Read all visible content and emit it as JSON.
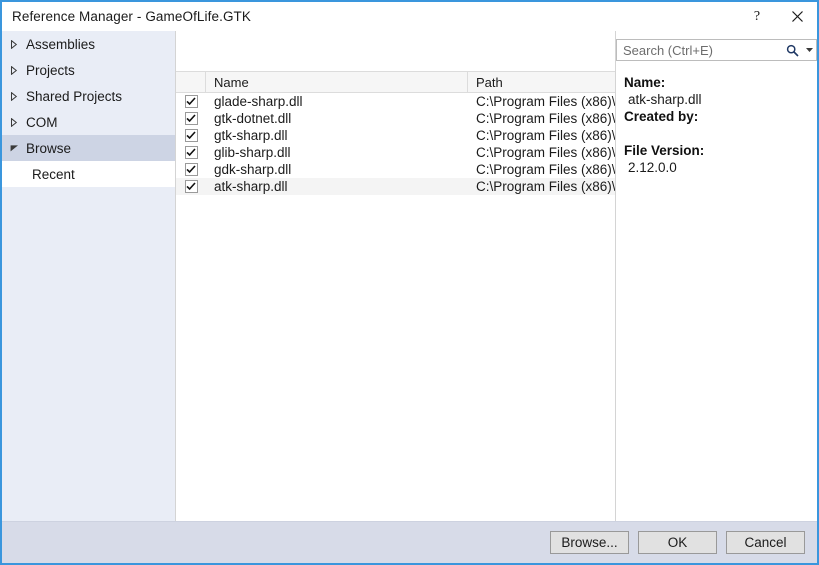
{
  "window": {
    "title": "Reference Manager - GameOfLife.GTK",
    "accent_color": "#3a96dd",
    "help_glyph": "?",
    "close_icon": "close-icon"
  },
  "sidebar": {
    "items": [
      {
        "label": "Assemblies",
        "state": "collapsed",
        "selected": false
      },
      {
        "label": "Projects",
        "state": "collapsed",
        "selected": false
      },
      {
        "label": "Shared Projects",
        "state": "collapsed",
        "selected": false
      },
      {
        "label": "COM",
        "state": "collapsed",
        "selected": false
      },
      {
        "label": "Browse",
        "state": "expanded",
        "selected": true
      },
      {
        "label": "Recent",
        "state": "child",
        "selected": false
      }
    ]
  },
  "search": {
    "placeholder": "Search (Ctrl+E)",
    "value": "",
    "icon": "search-icon",
    "caret": "chevron-down-icon"
  },
  "list": {
    "columns": [
      "",
      "Name",
      "Path"
    ],
    "rows": [
      {
        "checked": true,
        "name": "glade-sharp.dll",
        "path": "C:\\Program Files (x86)\\...",
        "selected": false
      },
      {
        "checked": true,
        "name": "gtk-dotnet.dll",
        "path": "C:\\Program Files (x86)\\...",
        "selected": false
      },
      {
        "checked": true,
        "name": "gtk-sharp.dll",
        "path": "C:\\Program Files (x86)\\...",
        "selected": false
      },
      {
        "checked": true,
        "name": "glib-sharp.dll",
        "path": "C:\\Program Files (x86)\\...",
        "selected": false
      },
      {
        "checked": true,
        "name": "gdk-sharp.dll",
        "path": "C:\\Program Files (x86)\\...",
        "selected": false
      },
      {
        "checked": true,
        "name": "atk-sharp.dll",
        "path": "C:\\Program Files (x86)\\...",
        "selected": true
      }
    ]
  },
  "details": {
    "name_label": "Name:",
    "name_value": "atk-sharp.dll",
    "created_by_label": "Created by:",
    "created_by_value": "",
    "file_version_label": "File Version:",
    "file_version_value": "2.12.0.0"
  },
  "footer": {
    "browse_label": "Browse...",
    "ok_label": "OK",
    "cancel_label": "Cancel"
  }
}
